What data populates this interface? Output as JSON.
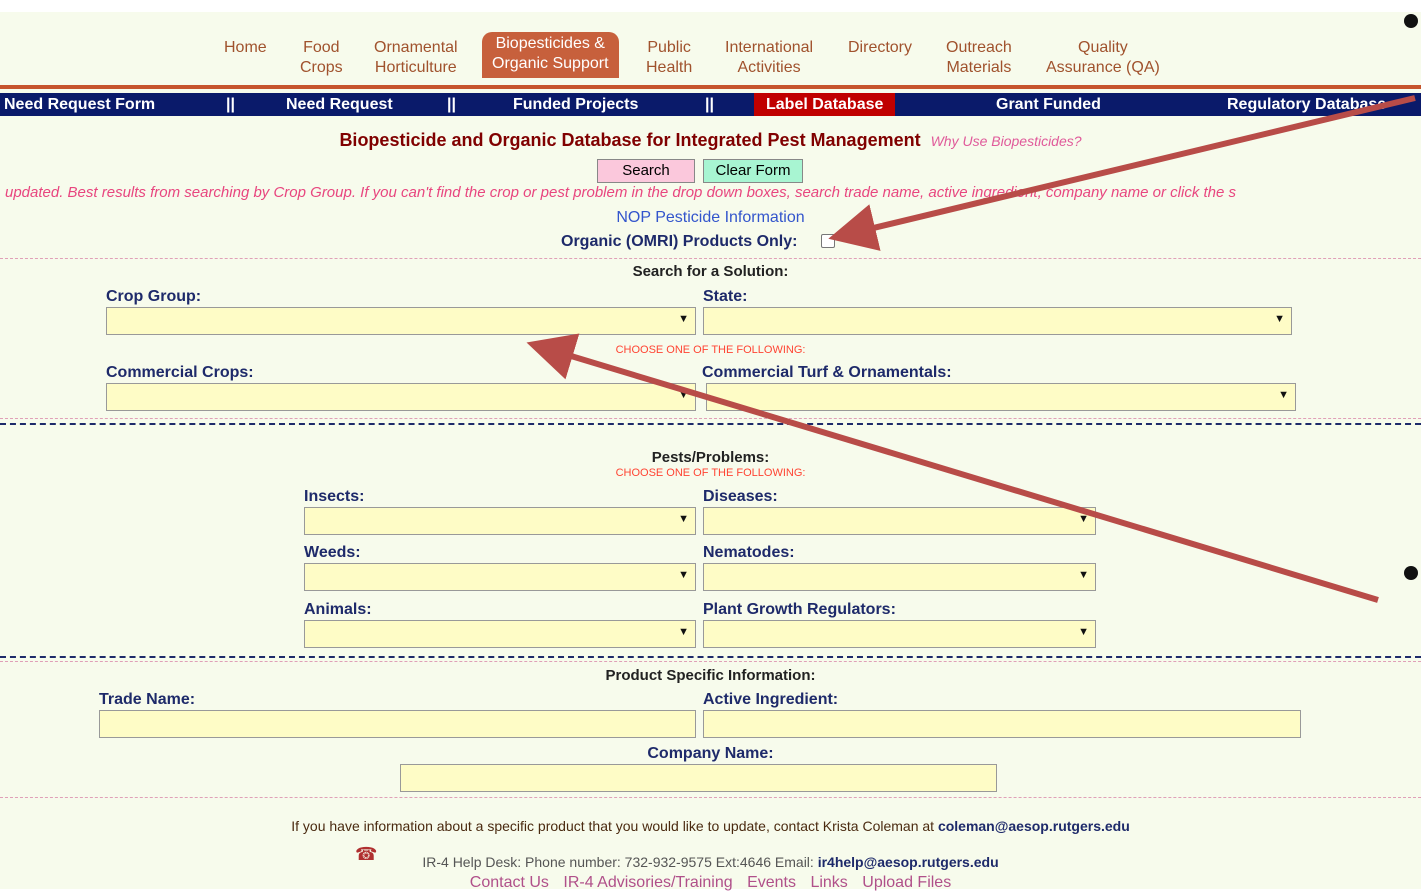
{
  "nav": {
    "items": [
      {
        "label": "Home"
      },
      {
        "label": "Food\nCrops"
      },
      {
        "label": "Ornamental\nHorticulture"
      },
      {
        "label": "Biopesticides &\nOrganic Support"
      },
      {
        "label": "Public\nHealth"
      },
      {
        "label": "International\nActivities"
      },
      {
        "label": "Directory"
      },
      {
        "label": "Outreach\nMaterials"
      },
      {
        "label": "Quality\nAssurance (QA)"
      }
    ]
  },
  "subnav": {
    "need_request_form": "Need Request Form",
    "sep": "||",
    "need_request": "Need Request",
    "funded_projects": "Funded Projects",
    "label_database": "Label Database",
    "grant_funded": "Grant Funded",
    "regulatory_database": "Regulatory Database"
  },
  "title": "Biopesticide and Organic Database for Integrated Pest Management",
  "why_link": "Why Use Biopesticides?",
  "buttons": {
    "search": "Search",
    "clear": "Clear Form"
  },
  "notice": "updated. Best results from searching by Crop Group. If you can't find the crop or pest problem in the drop down boxes, search trade name, active ingredient, company name or click the s",
  "nop_link": "NOP Pesticide Information",
  "organic_label": "Organic (OMRI) Products Only:",
  "search_solution": "Search for a Solution:",
  "choose_one": "CHOOSE ONE OF THE FOLLOWING:",
  "crop_group": "Crop Group:",
  "state": "State:",
  "commercial_crops": "Commercial Crops:",
  "commercial_turf": "Commercial Turf & Ornamentals:",
  "pests_title": "Pests/Problems:",
  "insects": "Insects:",
  "diseases": "Diseases:",
  "weeds": "Weeds:",
  "nematodes": "Nematodes:",
  "animals": "Animals:",
  "pgr": "Plant Growth Regulators:",
  "product_info": "Product Specific Information:",
  "trade_name": "Trade Name:",
  "active_ingredient": "Active Ingredient:",
  "company_name": "Company Name:",
  "footer": {
    "update_text": "If you have information about a specific product that you would like to update, contact Krista Coleman at",
    "update_email": "coleman@aesop.rutgers.edu",
    "help_text": "IR-4 Help Desk: Phone number: 732-932-9575 Ext:4646 Email:",
    "help_email": "ir4help@aesop.rutgers.edu",
    "links": [
      "Contact Us",
      "IR-4 Advisories/Training",
      "Events",
      "Links",
      "Upload Files"
    ]
  },
  "colors": {
    "nav_active": "#c7603c",
    "subnav_bg": "#0a1a6a",
    "field_bg": "#fefcc6",
    "arrow": "#b84c48"
  }
}
